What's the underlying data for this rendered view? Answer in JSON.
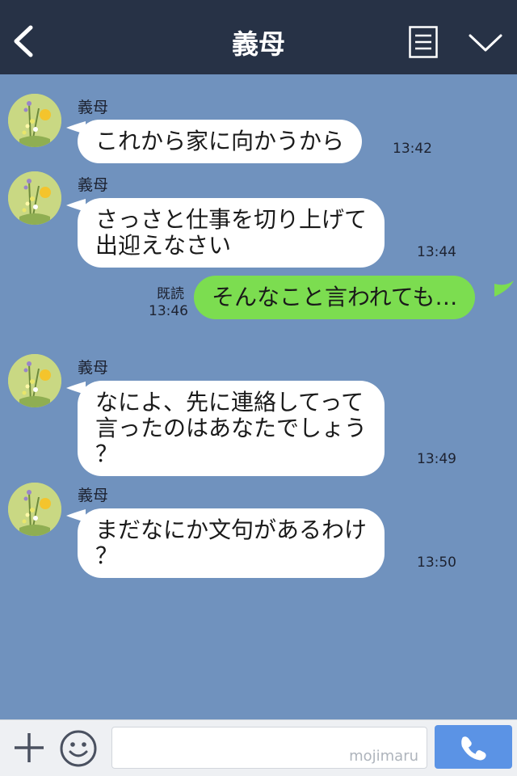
{
  "header": {
    "title": "義母",
    "back_icon": "back-chevron-icon",
    "menu_icon": "list-icon",
    "dropdown_icon": "chevron-down-icon"
  },
  "colors": {
    "header_bg": "#273246",
    "chat_bg": "#7092be",
    "incoming_bubble": "#ffffff",
    "outgoing_bubble": "#7cdd50",
    "call_button": "#5b93e5"
  },
  "messages": [
    {
      "direction": "in",
      "sender": "義母",
      "lines": [
        "これから家に向かうから"
      ],
      "time": "13:42"
    },
    {
      "direction": "in",
      "sender": "義母",
      "lines": [
        "さっさと仕事を切り上げて",
        "出迎えなさい"
      ],
      "time": "13:44"
    },
    {
      "direction": "out",
      "read_label": "既読",
      "lines": [
        "そんなこと言われても…"
      ],
      "time": "13:46"
    },
    {
      "direction": "in",
      "sender": "義母",
      "lines": [
        "なによ、先に連絡してって",
        "言ったのはあなたでしょう",
        "？"
      ],
      "time": "13:49"
    },
    {
      "direction": "in",
      "sender": "義母",
      "lines": [
        "まだなにか文句があるわけ",
        "？"
      ],
      "time": "13:50"
    }
  ],
  "footer": {
    "plus_icon": "plus-icon",
    "emoji_icon": "emoji-icon",
    "input_value": "",
    "watermark": "mojimaru",
    "call_icon": "phone-icon"
  }
}
